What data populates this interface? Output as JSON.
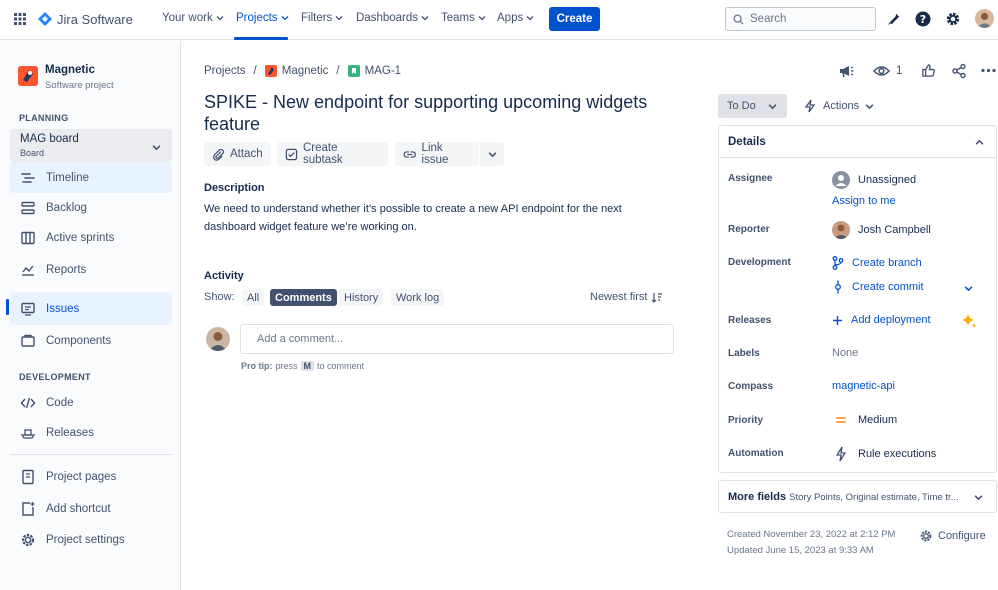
{
  "topnav": {
    "product": "Jira Software",
    "items": [
      "Your work",
      "Projects",
      "Filters",
      "Dashboards",
      "Teams",
      "Apps"
    ],
    "create": "Create",
    "search_placeholder": "Search"
  },
  "sidebar": {
    "project_name": "Magnetic",
    "project_type": "Software project",
    "planning_heading": "PLANNING",
    "board_name": "MAG board",
    "board_sub": "Board",
    "planning_items": [
      "Timeline",
      "Backlog",
      "Active sprints",
      "Reports"
    ],
    "issues": "Issues",
    "components": "Components",
    "development_heading": "DEVELOPMENT",
    "dev_items": [
      "Code",
      "Releases"
    ],
    "bottom_items": [
      "Project pages",
      "Add shortcut",
      "Project settings"
    ]
  },
  "breadcrumb": [
    "Projects",
    "/",
    "Magnetic",
    "/",
    "MAG-1"
  ],
  "issue": {
    "title": "SPIKE - New endpoint for supporting upcoming widgets feature",
    "watch_count": "1",
    "actions": [
      "Attach",
      "Create subtask",
      "Link issue"
    ],
    "description_label": "Description",
    "description": "We need to understand whether it’s possible to create a new API endpoint for the next dashboard widget feature we’re working on."
  },
  "activity": {
    "label": "Activity",
    "show": "Show:",
    "filters": [
      "All",
      "Comments",
      "History",
      "Work log"
    ],
    "sort": "Newest first",
    "comment_placeholder": "Add a comment...",
    "protip_bold": "Pro tip:",
    "protip_press": "press",
    "protip_key": "M",
    "protip_rest": "to comment"
  },
  "status": {
    "label": "To Do",
    "actions": "Actions"
  },
  "details": {
    "header": "Details",
    "rows": {
      "assignee": {
        "label": "Assignee",
        "value": "Unassigned",
        "link": "Assign to me"
      },
      "reporter": {
        "label": "Reporter",
        "value": "Josh Campbell"
      },
      "development": {
        "label": "Development",
        "branch": "Create branch",
        "commit": "Create commit"
      },
      "releases": {
        "label": "Releases",
        "value": "Add deployment"
      },
      "labels": {
        "label": "Labels",
        "value": "None"
      },
      "compass": {
        "label": "Compass",
        "value": "magnetic-api"
      },
      "priority": {
        "label": "Priority",
        "value": "Medium"
      },
      "automation": {
        "label": "Automation",
        "value": "Rule executions"
      }
    }
  },
  "more_fields": {
    "label": "More fields",
    "summary": "Story Points, Original estimate, Time tr..."
  },
  "meta": {
    "created": "Created November 23, 2022 at 2:12 PM",
    "updated": "Updated June 15, 2023 at 9:33 AM",
    "configure": "Configure"
  },
  "colors": {
    "brand": "#0052cc",
    "priority_medium": "#ff991f",
    "sparkle": "#ffab00"
  }
}
